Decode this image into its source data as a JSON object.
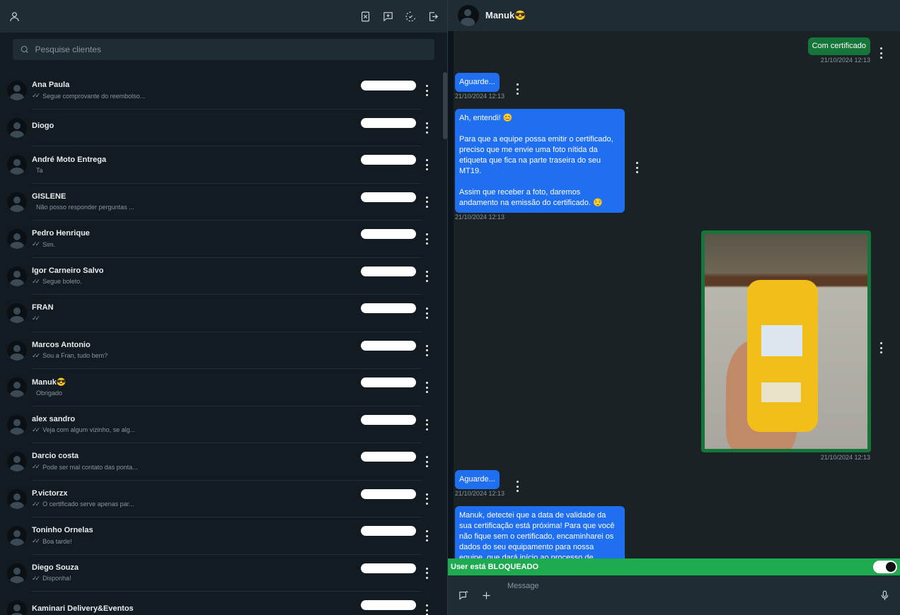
{
  "left": {
    "search_placeholder": "Pesquise clientes",
    "header_icons": [
      "user-icon",
      "close-square-icon",
      "new-chat-icon",
      "status-icon",
      "logout-icon"
    ],
    "contacts": [
      {
        "name": "Ana Paula",
        "ticks": "✓✓",
        "message": "Segue comprovante do reembolso..."
      },
      {
        "name": "Diogo",
        "ticks": "",
        "message": ""
      },
      {
        "name": "André Moto Entrega",
        "ticks": "",
        "message": "Ta"
      },
      {
        "name": "GISLENE",
        "ticks": "",
        "message": "Não posso responder perguntas ..."
      },
      {
        "name": "Pedro Henrique",
        "ticks": "✓✓",
        "message": "Sim."
      },
      {
        "name": "Igor Carneiro Salvo",
        "ticks": "✓✓",
        "message": "Segue boleto."
      },
      {
        "name": "FRAN",
        "ticks": "✓✓",
        "message": ""
      },
      {
        "name": "Marcos Antonio",
        "ticks": "✓✓",
        "message": "Sou a Fran, tudo bem?"
      },
      {
        "name": "Manuk😎",
        "ticks": "",
        "message": "Obrigado"
      },
      {
        "name": "alex sandro",
        "ticks": "✓✓",
        "message": "Veja com algum vizinho, se alg..."
      },
      {
        "name": "Darcio costa",
        "ticks": "✓✓",
        "message": "Pode ser mal contato das ponta..."
      },
      {
        "name": "P.victorzx",
        "ticks": "✓✓",
        "message": "O certificado serve apenas par..."
      },
      {
        "name": "Toninho Ornelas",
        "ticks": "✓✓",
        "message": "Boa tarde!"
      },
      {
        "name": "Diego Souza",
        "ticks": "✓✓",
        "message": "Disponha!"
      },
      {
        "name": "Kaminari Delivery&Eventos",
        "ticks": "",
        "message": ""
      }
    ]
  },
  "chat": {
    "contact_name": "Manuk😎",
    "messages": {
      "m1": {
        "text": "Com certificado",
        "time": "21/10/2024 12:13"
      },
      "m2": {
        "text": "Aguarde...",
        "time": "21/10/2024 12:13"
      },
      "m3": {
        "text": "Ah, entendi! 😊\n\nPara que a equipe possa emitir o certificado, preciso que me envie uma foto nítida da etiqueta que fica na parte traseira do seu MT19.\n\nAssim que receber a foto, daremos andamento na emissão do certificado. 😌",
        "time": "21/10/2024 12:13"
      },
      "m4": {
        "time": "21/10/2024 12:13"
      },
      "m5": {
        "text": "Aguarde...",
        "time": "21/10/2024 12:13"
      },
      "m6": {
        "text": "Manuk, detectei que a data de validade da sua certificação está próxima! Para que você não fique sem o certificado, encaminharei os dados do seu equipamento para nossa equipe, que dará início ao processo de"
      }
    },
    "blocked_text": "User está BLOQUEADO",
    "blocked_toggle_on": true,
    "composer_placeholder": "Message"
  }
}
